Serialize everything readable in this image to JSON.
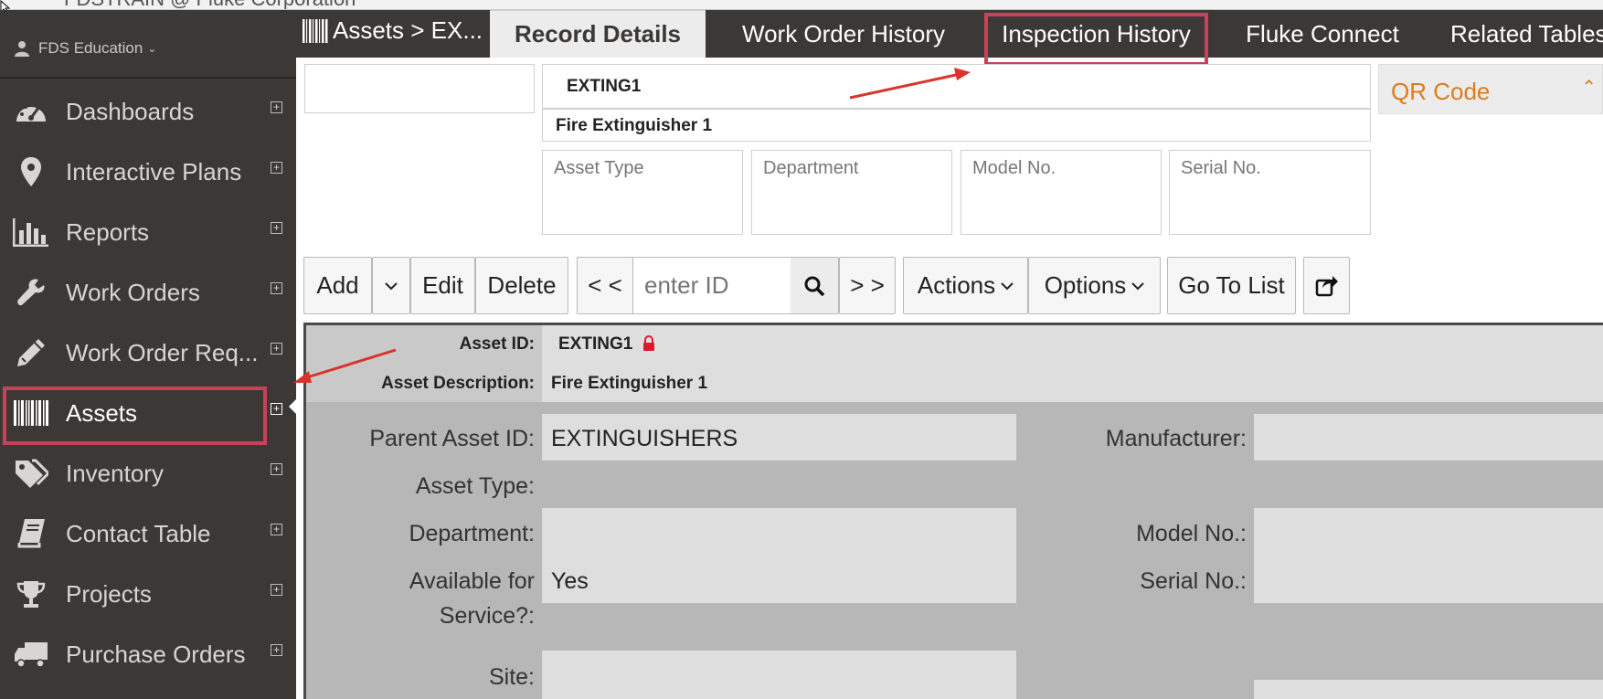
{
  "window": {
    "title": "FDSTRAIN @ Fluke Corporation"
  },
  "user": {
    "name": "FDS Education"
  },
  "sidebar": {
    "items": [
      {
        "label": "Dashboards",
        "icon": "dashboard-icon"
      },
      {
        "label": "Interactive Plans",
        "icon": "map-pin-icon"
      },
      {
        "label": "Reports",
        "icon": "bar-chart-icon"
      },
      {
        "label": "Work Orders",
        "icon": "wrench-icon"
      },
      {
        "label": "Work Order Req...",
        "icon": "pencil-icon"
      },
      {
        "label": "Assets",
        "icon": "barcode-icon",
        "active": true
      },
      {
        "label": "Inventory",
        "icon": "tags-icon"
      },
      {
        "label": "Contact Table",
        "icon": "book-icon"
      },
      {
        "label": "Projects",
        "icon": "trophy-icon"
      },
      {
        "label": "Purchase Orders",
        "icon": "truck-icon"
      }
    ]
  },
  "breadcrumb": {
    "text": "Assets > EX..."
  },
  "tabs": [
    {
      "label": "Record Details",
      "active": true
    },
    {
      "label": "Work Order History"
    },
    {
      "label": "Inspection History",
      "highlighted": true
    },
    {
      "label": "Fluke Connect"
    },
    {
      "label": "Related Tables"
    }
  ],
  "record": {
    "id": "EXTING1",
    "description": "Fire Extinguisher 1",
    "cards": [
      {
        "label": "Asset Type"
      },
      {
        "label": "Department"
      },
      {
        "label": "Model No."
      },
      {
        "label": "Serial No."
      }
    ]
  },
  "qr": {
    "label": "QR Code"
  },
  "toolbar": {
    "add": "Add",
    "edit": "Edit",
    "delete": "Delete",
    "prev": "< <",
    "id_placeholder": "enter ID",
    "next": "> >",
    "actions": "Actions",
    "options": "Options",
    "go_to_list": "Go To List"
  },
  "details": {
    "asset_id_label": "Asset ID:",
    "asset_id_value": "EXTING1",
    "asset_desc_label": "Asset Description:",
    "asset_desc_value": "Fire Extinguisher 1",
    "parent_label": "Parent Asset ID:",
    "parent_value": "EXTINGUISHERS",
    "asset_type_label": "Asset Type:",
    "department_label": "Department:",
    "available_label_1": "Available for",
    "available_label_2": "Service?:",
    "available_value": "Yes",
    "site_label": "Site:",
    "manufacturer_label": "Manufacturer:",
    "model_label": "Model No.:",
    "serial_label": "Serial No.:"
  },
  "colors": {
    "sidebar_bg": "#3b3835",
    "highlight": "#c8405a",
    "accent_orange": "#e07b1a",
    "annotation_arrow": "#d9342b"
  }
}
